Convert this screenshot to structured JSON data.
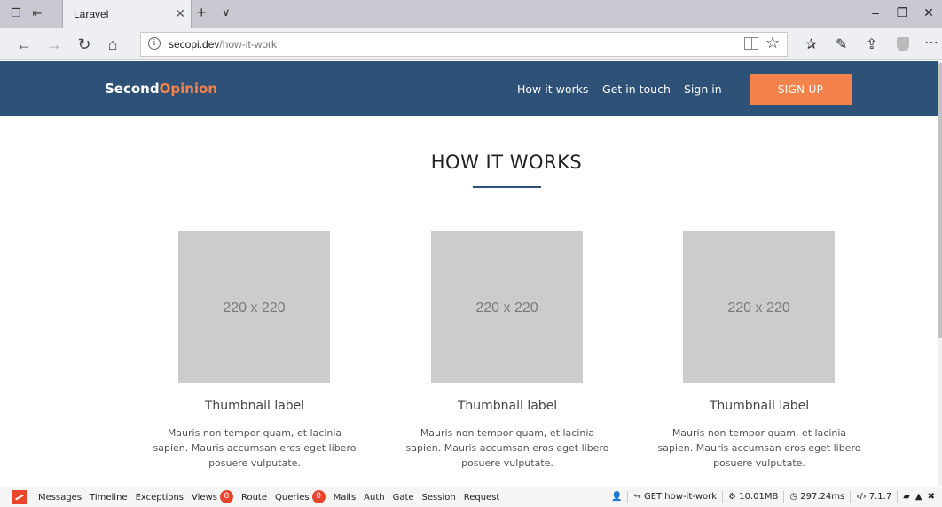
{
  "browser": {
    "tab_title": "Laravel",
    "url_host": "secopi.dev",
    "url_path": "/how-it-work"
  },
  "site": {
    "logo_primary": "Second",
    "logo_accent": "Opinion",
    "accent_color": "#f4824b",
    "brand_color": "#2e5178",
    "nav": [
      "How it works",
      "Get in touch",
      "Sign in"
    ],
    "signup_label": "SIGN UP"
  },
  "main": {
    "title": "HOW IT WORKS",
    "cards": [
      {
        "placeholder": "220 x 220",
        "label": "Thumbnail label",
        "description": "Mauris non tempor quam, et lacinia sapien. Mauris accumsan eros eget libero posuere vulputate."
      },
      {
        "placeholder": "220 x 220",
        "label": "Thumbnail label",
        "description": "Mauris non tempor quam, et lacinia sapien. Mauris accumsan eros eget libero posuere vulputate."
      },
      {
        "placeholder": "220 x 220",
        "label": "Thumbnail label",
        "description": "Mauris non tempor quam, et lacinia sapien. Mauris accumsan eros eget libero posuere vulputate."
      }
    ]
  },
  "debugbar": {
    "tabs": [
      {
        "label": "Messages"
      },
      {
        "label": "Timeline"
      },
      {
        "label": "Exceptions"
      },
      {
        "label": "Views",
        "badge": "8"
      },
      {
        "label": "Route"
      },
      {
        "label": "Queries",
        "badge": "0"
      },
      {
        "label": "Mails"
      },
      {
        "label": "Auth"
      },
      {
        "label": "Gate"
      },
      {
        "label": "Session"
      },
      {
        "label": "Request"
      }
    ],
    "request": "GET how-it-work",
    "memory": "10.01MB",
    "duration": "297.24ms",
    "php_version": "7.1.7"
  }
}
